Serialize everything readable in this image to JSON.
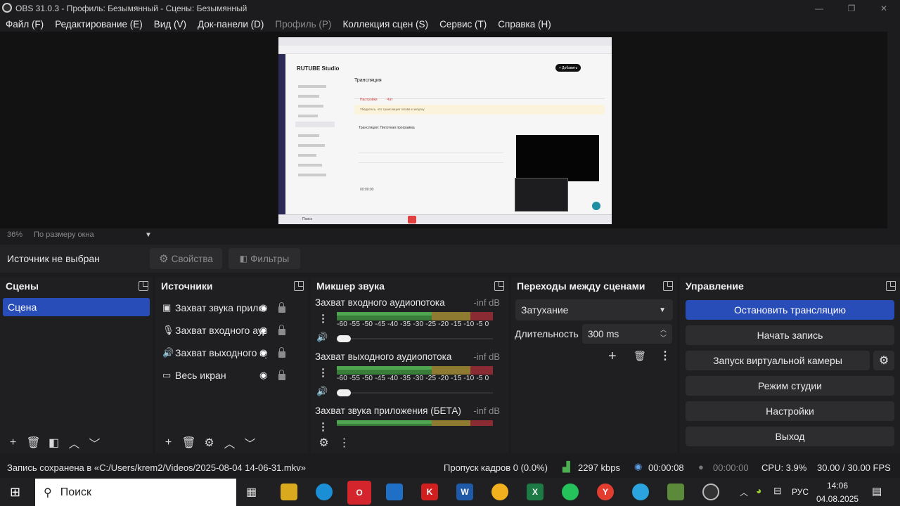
{
  "window": {
    "title": "OBS 31.0.3 - Профиль: Безымянный - Сцены: Безымянный",
    "min": "—",
    "max": "❐",
    "close": "✕"
  },
  "menu": [
    {
      "label": "Файл (F)",
      "enabled": true
    },
    {
      "label": "Редактирование (E)",
      "enabled": true
    },
    {
      "label": "Вид (V)",
      "enabled": true
    },
    {
      "label": "Док-панели (D)",
      "enabled": true
    },
    {
      "label": "Профиль (P)",
      "enabled": false
    },
    {
      "label": "Коллекция сцен (S)",
      "enabled": true
    },
    {
      "label": "Сервис (T)",
      "enabled": true
    },
    {
      "label": "Справка (H)",
      "enabled": true
    }
  ],
  "preview": {
    "brand": "RUTUBE Studio",
    "page_title": "Трансляция",
    "add_button": "+ Добавить",
    "tab_active": "Настройки",
    "tab_other": "Чат",
    "notice": "Убедитесь, что трансляция готова к запуску",
    "stream_title": "Трансляция: Пилотная программа",
    "stats": "00:00:00",
    "search_placeholder": "Поиск"
  },
  "zoom": {
    "percent": "36%",
    "mode": "По размеру окна"
  },
  "source_bar": {
    "status": "Источник не выбран",
    "properties": "Свойства",
    "filters": "Фильтры"
  },
  "scenes": {
    "title": "Сцены",
    "items": [
      "Сцена"
    ]
  },
  "sources": {
    "title": "Источники",
    "items": [
      {
        "icon": "speaker-app-icon",
        "label": "Захват звука приложения"
      },
      {
        "icon": "microphone-icon",
        "label": "Захват входного аудиопотока"
      },
      {
        "icon": "speaker-icon",
        "label": "Захват выходного аудиопотока"
      },
      {
        "icon": "monitor-icon",
        "label": "Весь икран"
      }
    ]
  },
  "mixer": {
    "title": "Микшер звука",
    "channels": [
      {
        "name": "Захват входного аудиопотока",
        "db": "-inf dB",
        "volume": 0
      },
      {
        "name": "Захват выходного аудиопотока",
        "db": "-inf dB",
        "volume": 0
      },
      {
        "name": "Захват звука приложения (БЕТА)",
        "db": "-inf dB",
        "volume": 0
      }
    ],
    "scale": [
      "-60",
      "-55",
      "-50",
      "-45",
      "-40",
      "-35",
      "-30",
      "-25",
      "-20",
      "-15",
      "-10",
      "-5",
      "0"
    ]
  },
  "transitions": {
    "title": "Переходы между сценами",
    "selected": "Затухание",
    "duration_label": "Длительность",
    "duration_value": "300 ms"
  },
  "controls": {
    "title": "Управление",
    "buttons": [
      "Остановить трансляцию",
      "Начать запись",
      "Запуск виртуальной камеры",
      "Режим студии",
      "Настройки",
      "Выход"
    ]
  },
  "status": {
    "message": "Запись сохранена в «C:/Users/krem2/Videos/2025-08-04 14-06-31.mkv»",
    "dropped": "Пропуск кадров 0 (0.0%)",
    "bitrate": "2297 kbps",
    "stream_time": "00:00:08",
    "rec_time": "00:00:00",
    "cpu": "CPU: 3.9%",
    "fps": "30.00 / 30.00 FPS"
  },
  "taskbar": {
    "search": "Поиск",
    "lang": "РУС",
    "time": "14:06",
    "date": "04.08.2025"
  },
  "colors": {
    "accent": "#284cb8",
    "bg": "#1c1c1e",
    "meter_green": "#3a7d3a",
    "meter_yellow": "#8f7a32",
    "meter_red": "#8a2a33"
  }
}
